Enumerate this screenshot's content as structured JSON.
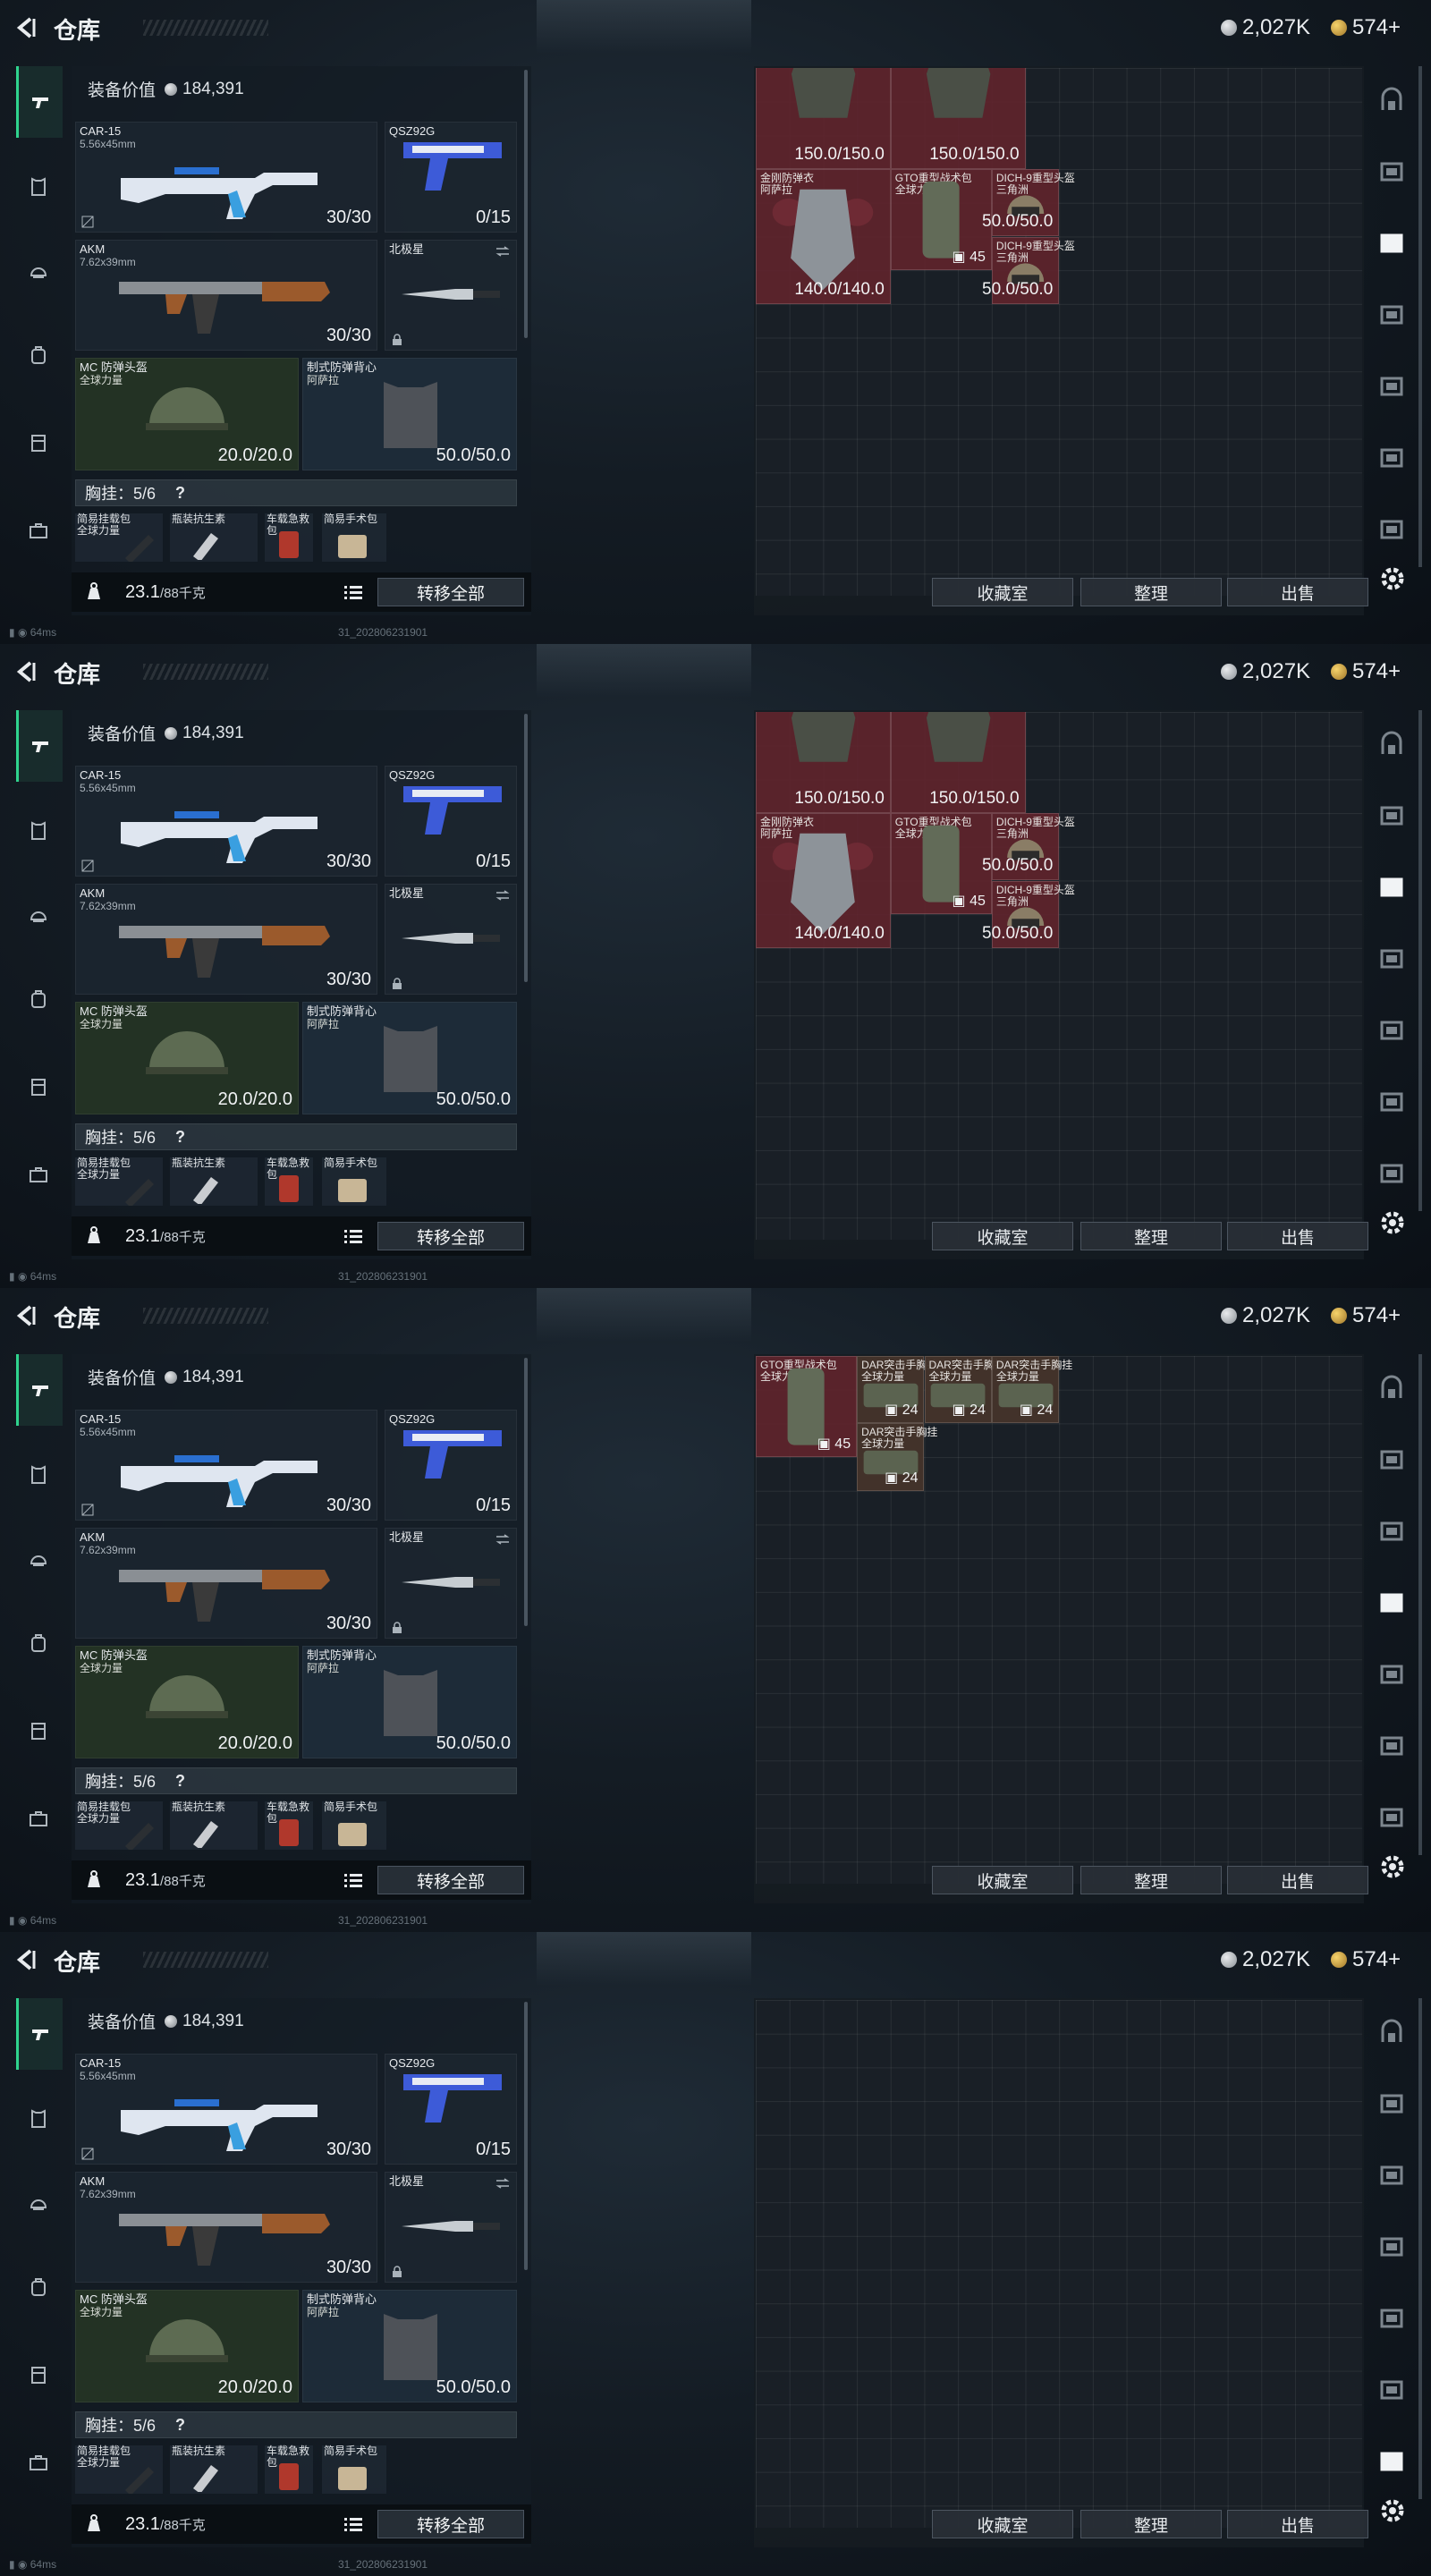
{
  "header": {
    "title": "仓库",
    "silver": "2,027K",
    "gold": "574+"
  },
  "equipment": {
    "value_label": "装备价值",
    "value": "184,391",
    "primary": {
      "name": "CAR-15",
      "sub": "5.56x45mm",
      "ammo": "30/30"
    },
    "pistol": {
      "name": "QSZ92G",
      "ammo": "0/15"
    },
    "secondary": {
      "name": "AKM",
      "sub": "7.62x39mm",
      "ammo": "30/30"
    },
    "knife": {
      "name": "北极星"
    },
    "helmet": {
      "name": "MC 防弹头盔",
      "sub": "全球力量",
      "dur": "20.0/20.0"
    },
    "vest": {
      "name": "制式防弹背心",
      "sub": "阿萨拉",
      "dur": "50.0/50.0"
    },
    "chest_rig": {
      "label": "胸挂：5/6",
      "q": "?"
    },
    "pouches": [
      "简易挂载包\n全球力量",
      "瓶装抗生素",
      "车载急救包",
      "简易手术包"
    ],
    "weight": "23.1",
    "weight_max": "/88千克",
    "transfer_all": "转移全部"
  },
  "footer": {
    "ping": "64ms",
    "build": "31_202806231901"
  },
  "storage": {
    "buttons": [
      "收藏室",
      "整理",
      "出售"
    ],
    "screen1": {
      "items": [
        {
          "name": "",
          "value": "150.0/150.0"
        },
        {
          "name": "",
          "value": "150.0/150.0"
        },
        {
          "name": "金刚防弹衣\n阿萨拉",
          "value": "140.0/140.0"
        },
        {
          "name": "GTO重型战术包\n全球力量",
          "count": "45"
        },
        {
          "name": "DICH-9重型头盔\n三角洲",
          "value": "50.0/50.0"
        },
        {
          "name": "DICH-9重型头盔\n三角洲",
          "value": "50.0/50.0"
        }
      ]
    },
    "screen3": {
      "items": [
        {
          "name": "GTO重型战术包\n全球力量",
          "count": "45"
        },
        {
          "name": "DAR突击手胸挂\n全球力量",
          "count": "24"
        },
        {
          "name": "DAR突击手胸挂\n全球力量",
          "count": "24"
        },
        {
          "name": "DAR突击手胸挂\n全球力量",
          "count": "24"
        },
        {
          "name": "DAR突击手胸挂\n全球力量",
          "count": "24"
        }
      ]
    }
  },
  "colors": {
    "accent_green": "#2fd38e",
    "item_red": "#60242c",
    "item_brown": "#443428"
  }
}
